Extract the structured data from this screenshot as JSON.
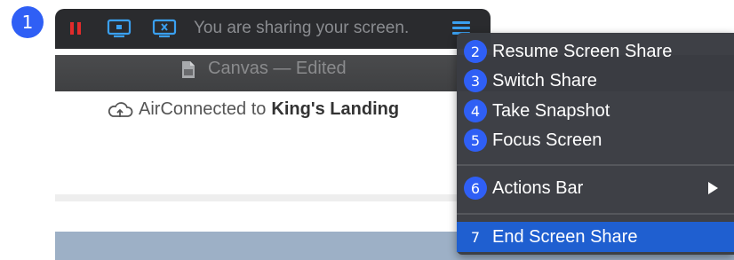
{
  "badge_main": "1",
  "share_bar": {
    "status_text": "You are sharing your screen.",
    "icons": [
      "pause-icon",
      "screen-share-icon",
      "stop-share-icon",
      "menu-icon"
    ],
    "pause_color": "#e22b2b",
    "accent_color": "#3aa0f0"
  },
  "window": {
    "title": "Canvas — Edited"
  },
  "content": {
    "air_prefix": "AirConnected to",
    "air_name": "King's Landing"
  },
  "menu": {
    "items": [
      {
        "badge": "2",
        "label": "Resume Screen Share"
      },
      {
        "badge": "3",
        "label": "Switch Share"
      },
      {
        "badge": "4",
        "label": "Take Snapshot"
      },
      {
        "badge": "5",
        "label": "Focus Screen"
      },
      {
        "badge": "6",
        "label": "Actions Bar"
      },
      {
        "badge": "7",
        "label": "End Screen Share"
      }
    ],
    "highlight_color": "#1f5fd0",
    "badge_color": "#2f5ff5"
  }
}
